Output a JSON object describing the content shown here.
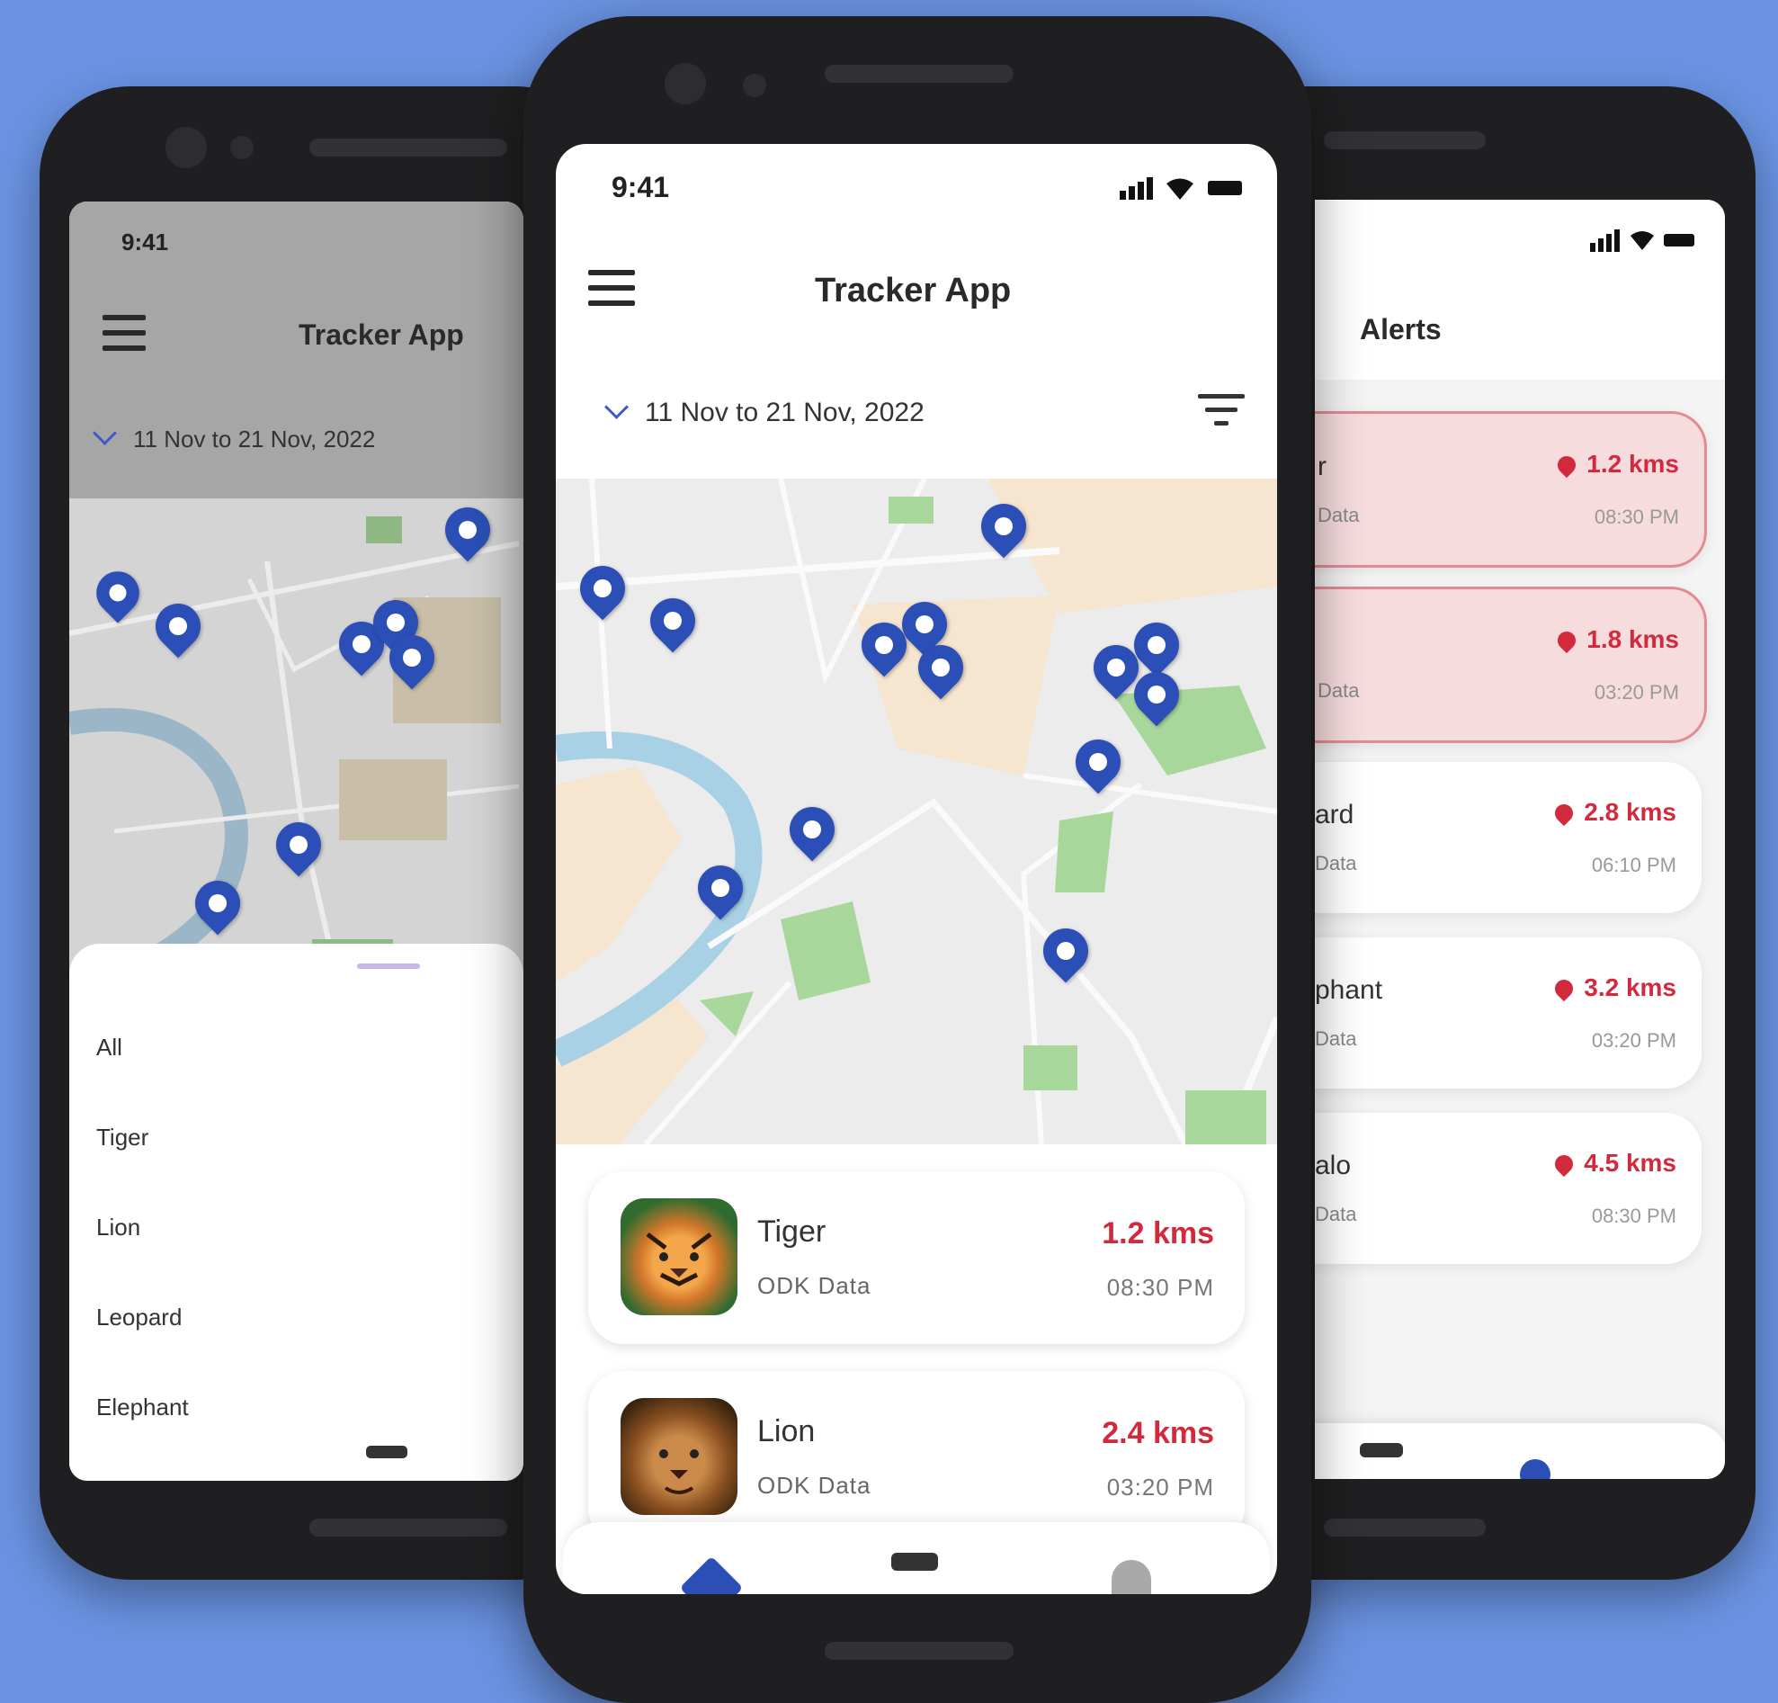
{
  "status_time": "9:41",
  "app_title": "Tracker App",
  "date_range": "11 Nov to 21 Nov, 2022",
  "filter_sheet": {
    "options": [
      "All",
      "Tiger",
      "Lion",
      "Leopard",
      "Elephant"
    ]
  },
  "tracking_list": [
    {
      "name": "Tiger",
      "source": "ODK Data",
      "distance": "1.2 kms",
      "time": "08:30 PM"
    },
    {
      "name": "Lion",
      "source": "ODK Data",
      "distance": "2.4 kms",
      "time": "03:20 PM"
    }
  ],
  "alerts": {
    "title": "Alerts",
    "items": [
      {
        "name": "r",
        "source": "Data",
        "distance": "1.2 kms",
        "time": "08:30 PM",
        "highlight": true
      },
      {
        "name": "",
        "source": "Data",
        "distance": "1.8 kms",
        "time": "03:20 PM",
        "highlight": true
      },
      {
        "name": "ard",
        "source": "Data",
        "distance": "2.8 kms",
        "time": "06:10 PM",
        "highlight": false
      },
      {
        "name": "phant",
        "source": "Data",
        "distance": "3.2 kms",
        "time": "03:20 PM",
        "highlight": false
      },
      {
        "name": "alo",
        "source": "Data",
        "distance": "4.5 kms",
        "time": "08:30 PM",
        "highlight": false
      }
    ]
  },
  "colors": {
    "background": "#6a93e2",
    "pin": "#2b4fb6",
    "distance": "#d22a3d",
    "accent": "#3b5bc8"
  },
  "icons": {
    "menu": "hamburger-menu-icon",
    "filter": "filter-icon",
    "pin": "map-pin-icon",
    "nav": [
      "home-icon",
      "tracker-device-icon",
      "bell-icon"
    ]
  }
}
